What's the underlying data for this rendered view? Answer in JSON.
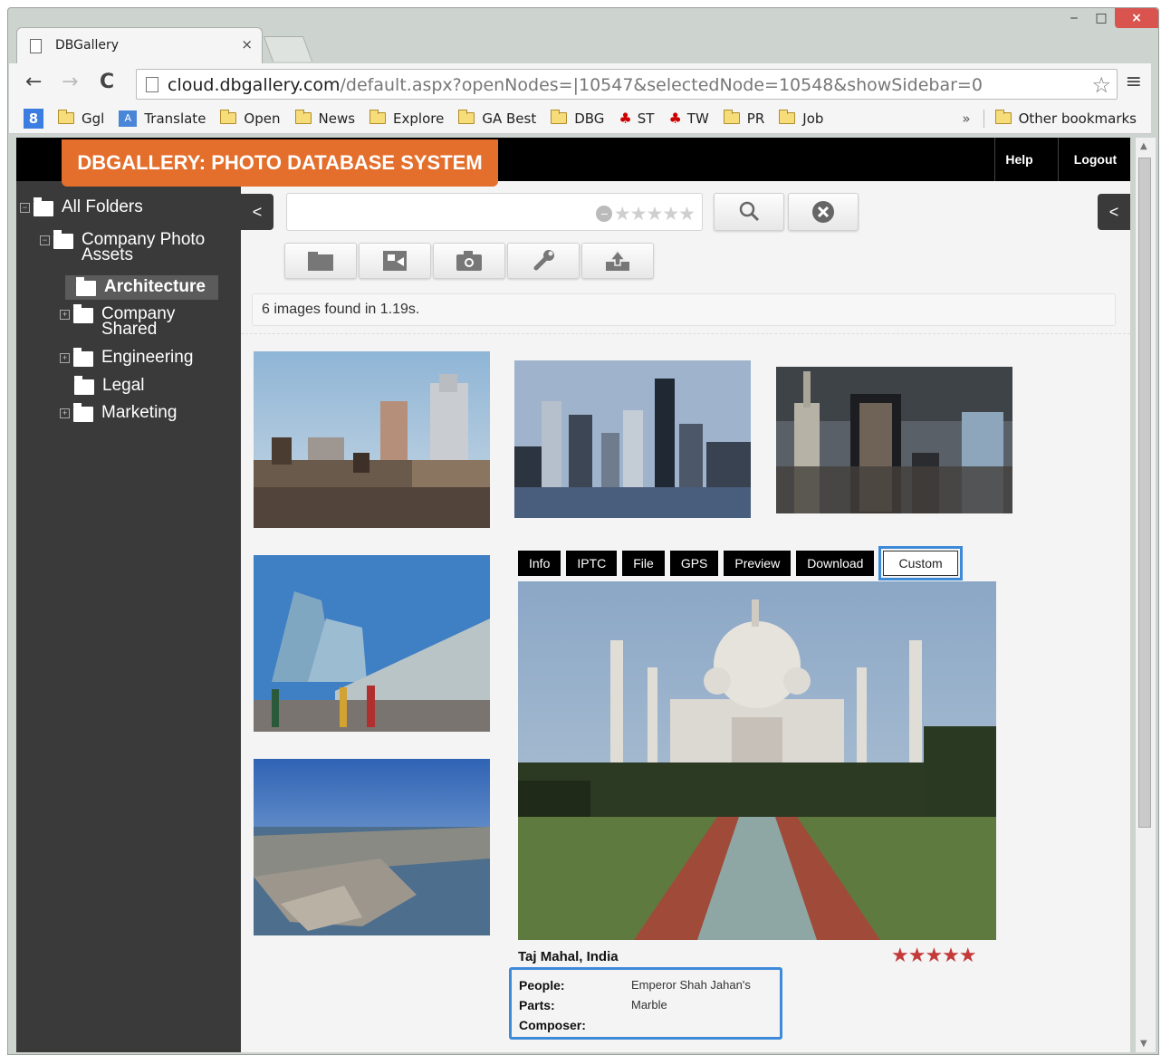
{
  "browser": {
    "tab_title": "DBGallery",
    "tab_close": "×",
    "url_host": "cloud.dbgallery.com",
    "url_path": "/default.aspx?openNodes=|10547&selectedNode=10548&showSidebar=0",
    "bookmarks": [
      "Ggl",
      "Translate",
      "Open",
      "News",
      "Explore",
      "GA Best",
      "DBG",
      "ST",
      "TW",
      "PR",
      "Job"
    ],
    "bookmarks_more": "»",
    "other_bookmarks": "Other bookmarks",
    "win_min": "‒",
    "win_max": "□",
    "win_close": "×"
  },
  "header": {
    "title": "DBGALLERY: PHOTO DATABASE SYSTEM",
    "help": "Help",
    "logout": "Logout"
  },
  "sidebar": {
    "root": "All Folders",
    "level1": [
      "Company Photo",
      "Assets"
    ],
    "items": [
      "Architecture",
      "Company",
      "Shared",
      "Engineering",
      "Legal",
      "Marketing"
    ],
    "collapse_label": "<"
  },
  "main": {
    "collapse_label": "<",
    "status": "6 images found in 1.19s.",
    "filter_rating": "★★★★★"
  },
  "detail": {
    "tabs": [
      "Info",
      "IPTC",
      "File",
      "GPS",
      "Preview",
      "Download",
      "Custom"
    ],
    "title": "Taj Mahal, India",
    "rating": "★★★★★",
    "rating_value": 5,
    "fields": [
      {
        "key": "People:",
        "value": "Emperor Shah Jahan's"
      },
      {
        "key": "Parts:",
        "value": "Marble"
      },
      {
        "key": "Composer:",
        "value": ""
      }
    ]
  },
  "colors": {
    "brand_orange": "#e46f2c",
    "sidebar_bg": "#3a3a3a",
    "highlight_blue": "#3d8ad9",
    "rating_red": "#c43a3a"
  }
}
